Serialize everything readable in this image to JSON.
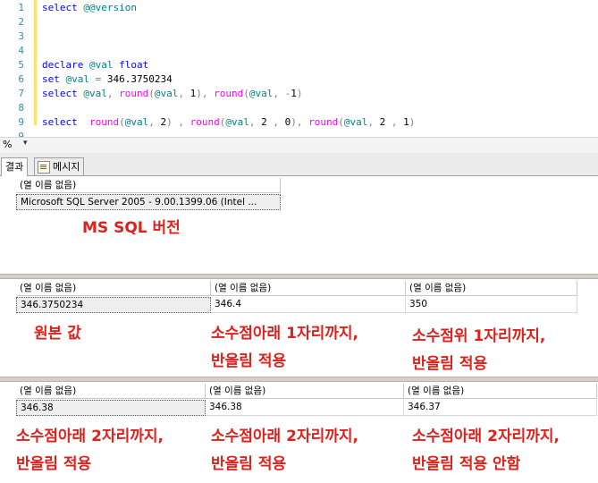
{
  "editor": {
    "lines": [
      {
        "n": "1",
        "tokens": [
          [
            "kw",
            "select "
          ],
          [
            "var",
            "@@version"
          ]
        ]
      },
      {
        "n": "2",
        "tokens": []
      },
      {
        "n": "3",
        "tokens": []
      },
      {
        "n": "4",
        "tokens": []
      },
      {
        "n": "5",
        "tokens": [
          [
            "kw",
            "declare "
          ],
          [
            "var",
            "@val "
          ],
          [
            "kw",
            "float"
          ]
        ]
      },
      {
        "n": "6",
        "tokens": [
          [
            "kw",
            "set "
          ],
          [
            "var",
            "@val "
          ],
          [
            "op",
            "= "
          ],
          [
            "txt",
            "346.3750234"
          ]
        ]
      },
      {
        "n": "7",
        "tokens": [
          [
            "kw",
            "select "
          ],
          [
            "var",
            "@val"
          ],
          [
            "op",
            ", "
          ],
          [
            "fn",
            "round"
          ],
          [
            "op",
            "("
          ],
          [
            "var",
            "@val"
          ],
          [
            "op",
            ", "
          ],
          [
            "txt",
            "1"
          ],
          [
            "op",
            "), "
          ],
          [
            "fn",
            "round"
          ],
          [
            "op",
            "("
          ],
          [
            "var",
            "@val"
          ],
          [
            "op",
            ", -"
          ],
          [
            "txt",
            "1"
          ],
          [
            "op",
            ")"
          ]
        ]
      },
      {
        "n": "8",
        "tokens": []
      },
      {
        "n": "9",
        "tokens": [
          [
            "kw",
            "select  "
          ],
          [
            "fn",
            "round"
          ],
          [
            "op",
            "("
          ],
          [
            "var",
            "@val"
          ],
          [
            "op",
            ", "
          ],
          [
            "txt",
            "2"
          ],
          [
            "op",
            ") , "
          ],
          [
            "fn",
            "round"
          ],
          [
            "op",
            "("
          ],
          [
            "var",
            "@val"
          ],
          [
            "op",
            ", "
          ],
          [
            "txt",
            "2 "
          ],
          [
            "op",
            ", "
          ],
          [
            "txt",
            "0"
          ],
          [
            "op",
            "), "
          ],
          [
            "fn",
            "round"
          ],
          [
            "op",
            "("
          ],
          [
            "var",
            "@val"
          ],
          [
            "op",
            ", "
          ],
          [
            "txt",
            "2 "
          ],
          [
            "op",
            ", "
          ],
          [
            "txt",
            "1"
          ],
          [
            "op",
            ")"
          ]
        ]
      },
      {
        "n": "9",
        "tokens": []
      }
    ]
  },
  "zoom": {
    "label": "%",
    "arrow": "▾"
  },
  "tabs": {
    "results": "결과",
    "messages": "메시지"
  },
  "grid1": {
    "header": "(열 이름 없음)",
    "value": "Microsoft SQL Server 2005 - 9.00.1399.06 (Intel ..."
  },
  "grid2": {
    "headers": [
      "(열 이름 없음)",
      "(열 이름 없음)",
      "(열 이름 없음)"
    ],
    "values": [
      "346.3750234",
      "346.4",
      "350"
    ]
  },
  "grid3": {
    "headers": [
      "(열 이름 없음)",
      "(열 이름 없음)",
      "(열 이름 없음)"
    ],
    "values": [
      "346.38",
      "346.38",
      "346.37"
    ]
  },
  "annotations": {
    "a1": "MS SQL 버전",
    "a2": "원본 값",
    "a3_1": "소수점아래 1자리까지,",
    "a3_2": "반올림 적용",
    "a4_1": "소수점위 1자리까지,",
    "a4_2": "반올림 적용",
    "a5_1": "소수점아래 2자리까지,",
    "a5_2": "반올림 적용",
    "a6_1": "소수점아래 2자리까지,",
    "a6_2": "반올림 적용",
    "a7_1": "소수점아래 2자리까지,",
    "a7_2": "반올림 적용 안함"
  },
  "colors": {
    "keyword": "#0000ff",
    "function": "#ff00ff",
    "variable": "#008080",
    "annotation": "#e0201a"
  }
}
